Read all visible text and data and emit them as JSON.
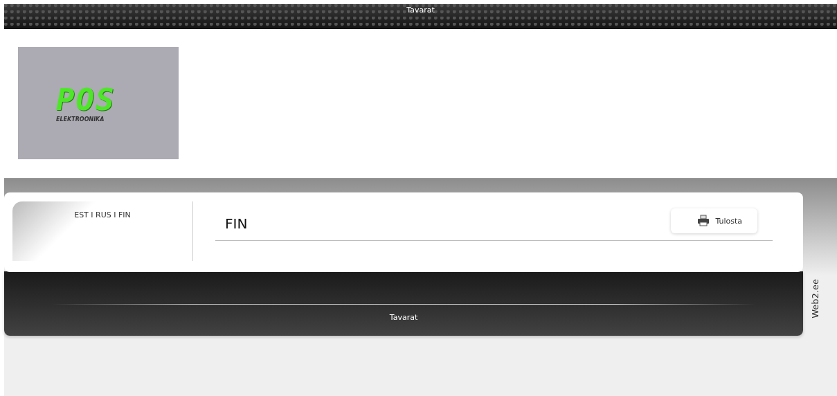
{
  "top_bar": {
    "title": "Tavarat"
  },
  "logo": {
    "mark": "POS",
    "subtitle": "ELEKTROONIKA"
  },
  "sidebar": {
    "language_links": "EST I RUS I FIN"
  },
  "content": {
    "heading": "FIN",
    "print_button": "Tulosta"
  },
  "footer": {
    "title": "Tavarat"
  },
  "credit": "Web2.ee"
}
